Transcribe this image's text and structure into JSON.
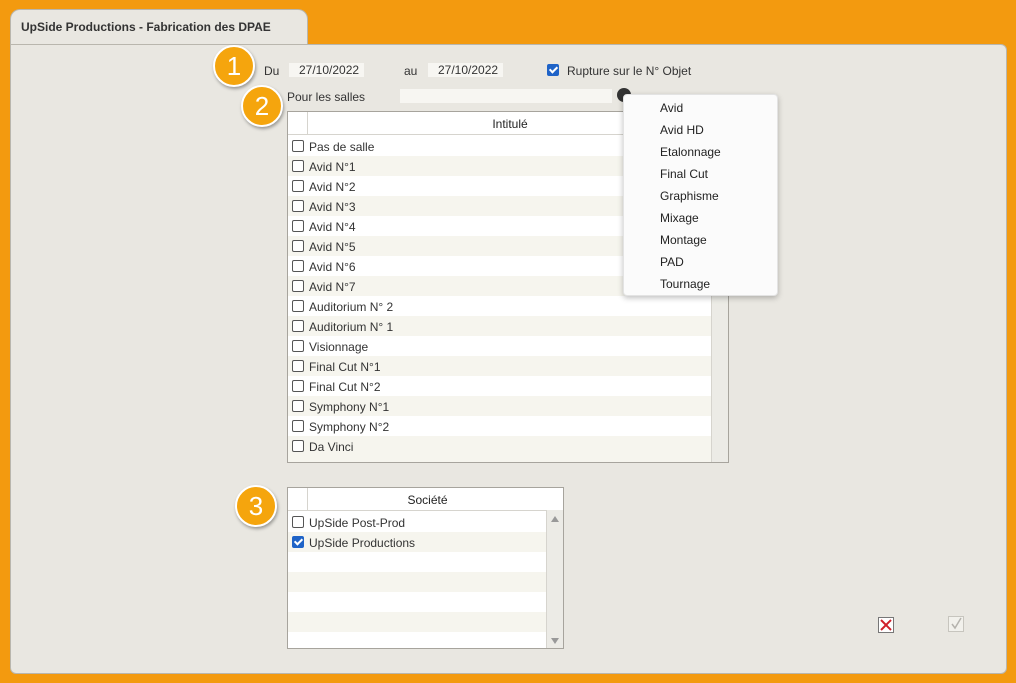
{
  "window": {
    "title": "UpSide Productions - Fabrication des DPAE"
  },
  "badges": [
    "1",
    "2",
    "3"
  ],
  "dates": {
    "from_label": "Du",
    "from_value": "27/10/2022",
    "to_label": "au",
    "to_value": "27/10/2022"
  },
  "rupture": {
    "label": "Rupture sur le N° Objet",
    "checked": true
  },
  "salles": {
    "label": "Pour les salles",
    "value": ""
  },
  "rooms_table": {
    "header": "Intitulé",
    "rows": [
      "Pas de salle",
      "Avid N°1",
      "Avid N°2",
      "Avid N°3",
      "Avid N°4",
      "Avid N°5",
      "Avid N°6",
      "Avid N°7",
      "Auditorium N° 2",
      "Auditorium N° 1",
      "Visionnage",
      "Final Cut N°1",
      "Final Cut N°2",
      "Symphony N°1",
      "Symphony N°2",
      "Da Vinci"
    ]
  },
  "dropdown": {
    "items": [
      "Avid",
      "Avid HD",
      "Etalonnage",
      "Final Cut",
      "Graphisme",
      "Mixage",
      "Montage",
      "PAD",
      "Tournage"
    ]
  },
  "company_table": {
    "header": "Société",
    "rows": [
      {
        "label": "UpSide Post-Prod",
        "checked": false
      },
      {
        "label": "UpSide Productions",
        "checked": true
      }
    ]
  },
  "buttons": {
    "cancel_icon": "close-icon",
    "ok_icon": "check-icon"
  },
  "colors": {
    "accent": "#f39a0f",
    "badge": "#f5a50d",
    "checkbox_checked": "#1f63c7"
  }
}
